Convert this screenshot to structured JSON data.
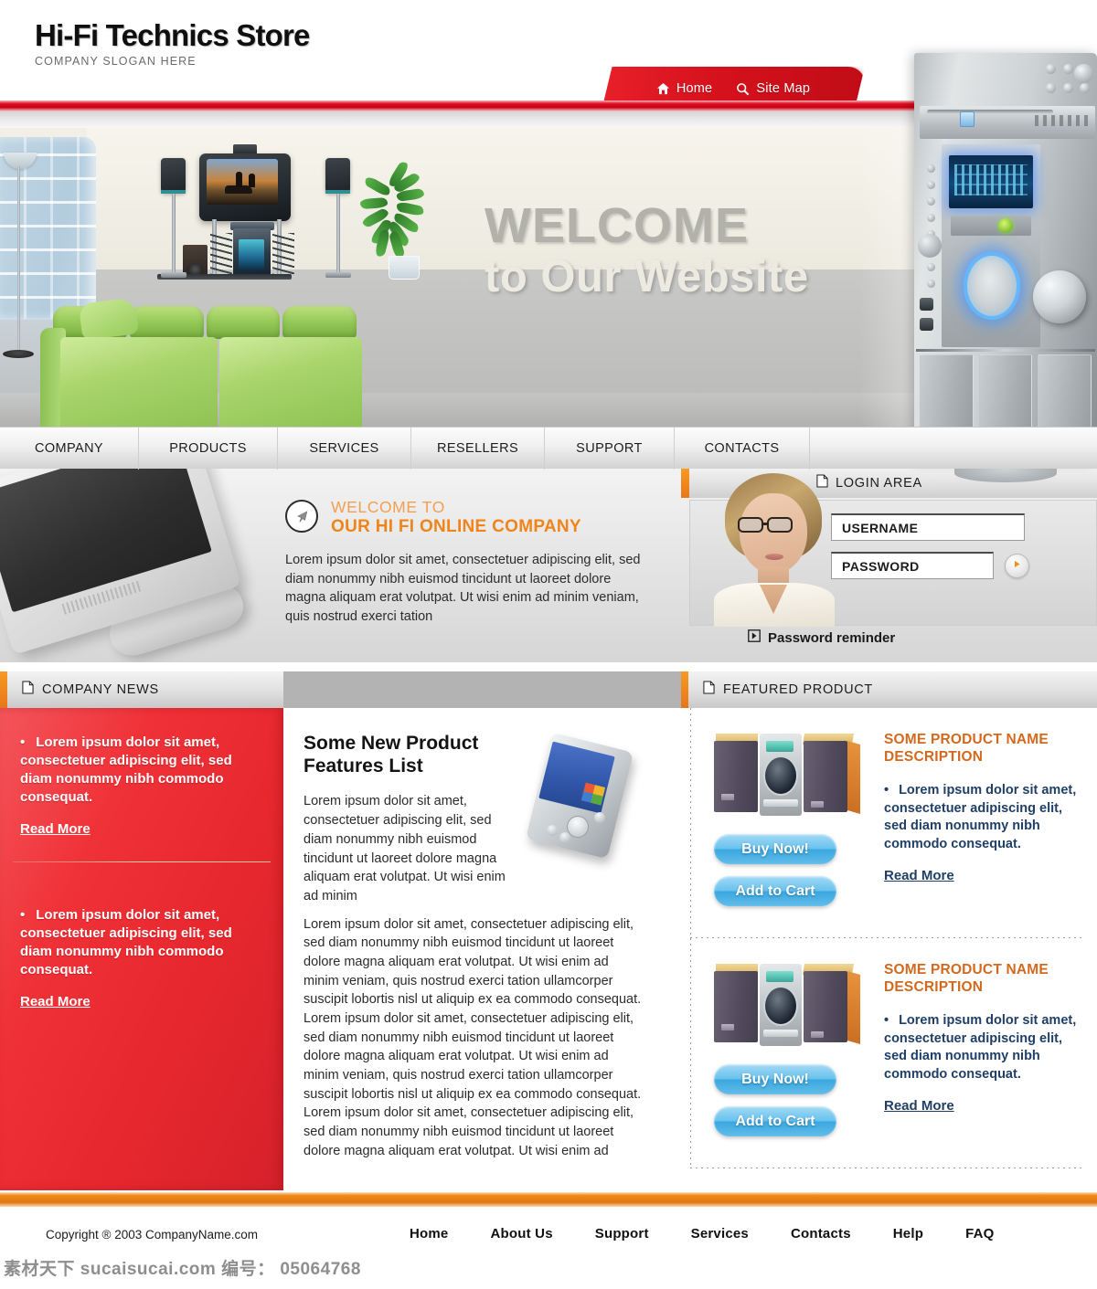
{
  "header": {
    "logo_title": "Hi-Fi Technics Store",
    "logo_slogan": "COMPANY SLOGAN HERE",
    "top_nav": [
      {
        "label": "Home",
        "icon": "home-icon"
      },
      {
        "label": "Site Map",
        "icon": "search-icon"
      }
    ]
  },
  "hero": {
    "welcome_line1": "WELCOME",
    "welcome_line2": "to Our Website"
  },
  "main_nav": [
    {
      "label": "COMPANY"
    },
    {
      "label": "PRODUCTS"
    },
    {
      "label": "SERVICES"
    },
    {
      "label": "RESELLERS"
    },
    {
      "label": "SUPPORT"
    },
    {
      "label": "CONTACTS"
    }
  ],
  "welcome": {
    "heading_small": "WELCOME TO",
    "heading_big": "OUR HI FI ONLINE COMPANY",
    "body": "Lorem ipsum dolor sit amet, consectetuer adipiscing elit, sed diam nonummy nibh euismod tincidunt ut laoreet dolore magna aliquam erat volutpat. Ut wisi enim ad minim veniam, quis nostrud exerci tation"
  },
  "login": {
    "title": "LOGIN AREA",
    "username_value": "USERNAME",
    "username_placeholder": "USERNAME",
    "password_value": "PASSWORD",
    "password_placeholder": "PASSWORD",
    "submit_icon": "play-arrow-icon",
    "reminder_label": "Password reminder"
  },
  "sections": {
    "news_title": "COMPANY NEWS",
    "featured_title": "FEATURED PRODUCT"
  },
  "news": {
    "items": [
      {
        "bullet": "•",
        "text": "Lorem ipsum dolor sit amet, consectetuer adipiscing elit, sed diam nonummy nibh commodo consequat.",
        "read_more": "Read More"
      },
      {
        "bullet": "•",
        "text": "Lorem ipsum dolor sit amet, consectetuer adipiscing elit, sed diam nonummy nibh commodo consequat.",
        "read_more": "Read More"
      }
    ]
  },
  "center": {
    "heading": "Some New Product Features List",
    "intro": "Lorem ipsum dolor sit amet, consectetuer adipiscing elit, sed diam nonummy nibh euismod tincidunt ut laoreet dolore magna aliquam erat volutpat. Ut wisi enim ad minim",
    "body": "Lorem ipsum dolor sit amet, consectetuer adipiscing elit, sed diam nonummy nibh euismod tincidunt ut laoreet dolore magna aliquam erat volutpat. Ut wisi enim ad minim veniam, quis nostrud exerci tation ullamcorper suscipit lobortis nisl ut aliquip ex ea commodo consequat. Lorem ipsum dolor sit amet, consectetuer adipiscing elit, sed diam nonummy nibh euismod tincidunt ut laoreet dolore magna aliquam erat volutpat. Ut wisi enim ad minim veniam, quis nostrud exerci tation ullamcorper suscipit lobortis nisl ut aliquip ex ea commodo consequat. Lorem ipsum dolor sit amet, consectetuer adipiscing elit, sed diam nonummy nibh euismod tincidunt ut laoreet dolore magna aliquam erat volutpat. Ut wisi enim ad"
  },
  "products": [
    {
      "title": "SOME PRODUCT NAME DESCRIPTION",
      "bullet": "•",
      "description": "Lorem ipsum dolor sit amet, consectetuer adipiscing elit, sed diam nonummy nibh commodo consequat.",
      "read_more": "Read More",
      "buy_label": "Buy Now!",
      "cart_label": "Add to Cart"
    },
    {
      "title": "SOME PRODUCT NAME DESCRIPTION",
      "bullet": "•",
      "description": "Lorem ipsum dolor sit amet, consectetuer adipiscing elit, sed diam nonummy nibh commodo consequat.",
      "read_more": "Read More",
      "buy_label": "Buy Now!",
      "cart_label": "Add to Cart"
    }
  ],
  "footer": {
    "copyright": "Copyright ® 2003 CompanyName.com",
    "links": [
      {
        "label": "Home"
      },
      {
        "label": "About Us"
      },
      {
        "label": "Support"
      },
      {
        "label": "Services"
      },
      {
        "label": "Contacts"
      },
      {
        "label": "Help"
      },
      {
        "label": "FAQ"
      }
    ]
  },
  "watermark": {
    "text": "素材天下 sucaisucai.com 编号： 05064768"
  },
  "colors": {
    "red": "#e8282f",
    "orange": "#ef8519",
    "blue_button": "#69c2ee",
    "product_title": "#d2691e",
    "product_text": "#1f3f66"
  }
}
